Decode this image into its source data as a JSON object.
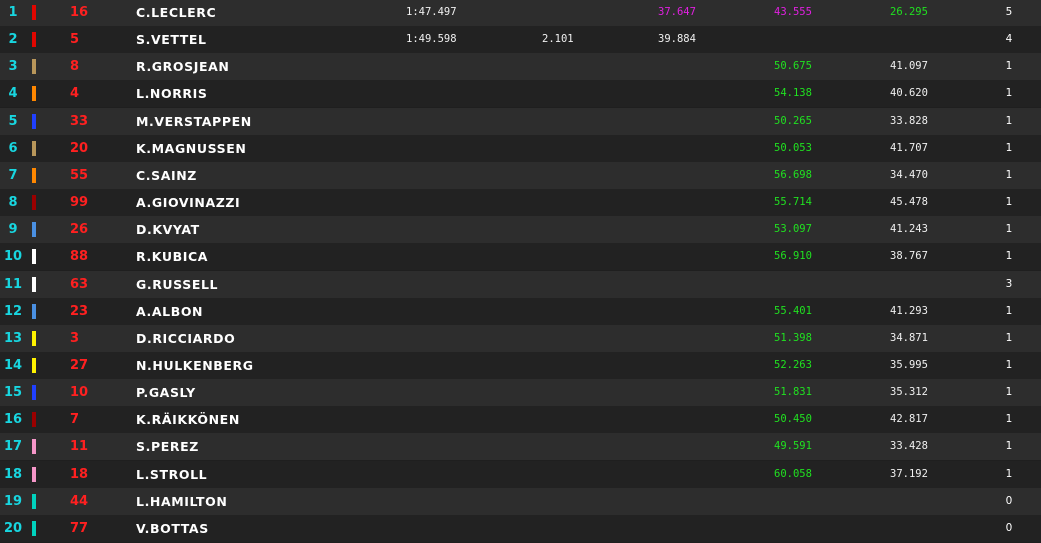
{
  "colors": {
    "position": "#18d6e0",
    "car_number": "#ff2020",
    "driver": "#ffffff",
    "purple_sector": "#e020e0",
    "green_sector": "#20e020",
    "row_odd": "#2d2d2d",
    "row_even": "#222222"
  },
  "rows": [
    {
      "pos": "1",
      "team_color": "#e10600",
      "num": "16",
      "driver": "C.LECLERC",
      "best": "1:47.497",
      "gap": "",
      "s1": "37.647",
      "s1_class": "purple",
      "s2": "43.555",
      "s2_class": "purple",
      "s3": "26.295",
      "s3_class": "green",
      "pits": "5"
    },
    {
      "pos": "2",
      "team_color": "#e10600",
      "num": "5",
      "driver": "S.VETTEL",
      "best": "1:49.598",
      "gap": "2.101",
      "s1": "39.884",
      "s1_class": "white",
      "s2": "",
      "s2_class": "white",
      "s3": "",
      "s3_class": "white",
      "pits": "4"
    },
    {
      "pos": "3",
      "team_color": "#b8965a",
      "num": "8",
      "driver": "R.GROSJEAN",
      "best": "",
      "gap": "",
      "s1": "",
      "s1_class": "white",
      "s2": "50.675",
      "s2_class": "green",
      "s3": "41.097",
      "s3_class": "white",
      "pits": "1"
    },
    {
      "pos": "4",
      "team_color": "#ff8700",
      "num": "4",
      "driver": "L.NORRIS",
      "best": "",
      "gap": "",
      "s1": "",
      "s1_class": "white",
      "s2": "54.138",
      "s2_class": "green",
      "s3": "40.620",
      "s3_class": "white",
      "pits": "1"
    },
    {
      "pos": "5",
      "team_color": "#2040ff",
      "num": "33",
      "driver": "M.VERSTAPPEN",
      "best": "",
      "gap": "",
      "s1": "",
      "s1_class": "white",
      "s2": "50.265",
      "s2_class": "green",
      "s3": "33.828",
      "s3_class": "white",
      "pits": "1"
    },
    {
      "pos": "6",
      "team_color": "#b8965a",
      "num": "20",
      "driver": "K.MAGNUSSEN",
      "best": "",
      "gap": "",
      "s1": "",
      "s1_class": "white",
      "s2": "50.053",
      "s2_class": "green",
      "s3": "41.707",
      "s3_class": "white",
      "pits": "1"
    },
    {
      "pos": "7",
      "team_color": "#ff8700",
      "num": "55",
      "driver": "C.SAINZ",
      "best": "",
      "gap": "",
      "s1": "",
      "s1_class": "white",
      "s2": "56.698",
      "s2_class": "green",
      "s3": "34.470",
      "s3_class": "white",
      "pits": "1"
    },
    {
      "pos": "8",
      "team_color": "#9b0000",
      "num": "99",
      "driver": "A.GIOVINAZZI",
      "best": "",
      "gap": "",
      "s1": "",
      "s1_class": "white",
      "s2": "55.714",
      "s2_class": "green",
      "s3": "45.478",
      "s3_class": "white",
      "pits": "1"
    },
    {
      "pos": "9",
      "team_color": "#4a90e2",
      "num": "26",
      "driver": "D.KVYAT",
      "best": "",
      "gap": "",
      "s1": "",
      "s1_class": "white",
      "s2": "53.097",
      "s2_class": "green",
      "s3": "41.243",
      "s3_class": "white",
      "pits": "1"
    },
    {
      "pos": "10",
      "team_color": "#ffffff",
      "num": "88",
      "driver": "R.KUBICA",
      "best": "",
      "gap": "",
      "s1": "",
      "s1_class": "white",
      "s2": "56.910",
      "s2_class": "green",
      "s3": "38.767",
      "s3_class": "white",
      "pits": "1"
    },
    {
      "pos": "11",
      "team_color": "#ffffff",
      "num": "63",
      "driver": "G.RUSSELL",
      "best": "",
      "gap": "",
      "s1": "",
      "s1_class": "white",
      "s2": "",
      "s2_class": "white",
      "s3": "",
      "s3_class": "white",
      "pits": "3"
    },
    {
      "pos": "12",
      "team_color": "#4a90e2",
      "num": "23",
      "driver": "A.ALBON",
      "best": "",
      "gap": "",
      "s1": "",
      "s1_class": "white",
      "s2": "55.401",
      "s2_class": "green",
      "s3": "41.293",
      "s3_class": "white",
      "pits": "1"
    },
    {
      "pos": "13",
      "team_color": "#fff200",
      "num": "3",
      "driver": "D.RICCIARDO",
      "best": "",
      "gap": "",
      "s1": "",
      "s1_class": "white",
      "s2": "51.398",
      "s2_class": "green",
      "s3": "34.871",
      "s3_class": "white",
      "pits": "1"
    },
    {
      "pos": "14",
      "team_color": "#fff200",
      "num": "27",
      "driver": "N.HULKENBERG",
      "best": "",
      "gap": "",
      "s1": "",
      "s1_class": "white",
      "s2": "52.263",
      "s2_class": "green",
      "s3": "35.995",
      "s3_class": "white",
      "pits": "1"
    },
    {
      "pos": "15",
      "team_color": "#2040ff",
      "num": "10",
      "driver": "P.GASLY",
      "best": "",
      "gap": "",
      "s1": "",
      "s1_class": "white",
      "s2": "51.831",
      "s2_class": "green",
      "s3": "35.312",
      "s3_class": "white",
      "pits": "1"
    },
    {
      "pos": "16",
      "team_color": "#9b0000",
      "num": "7",
      "driver": "K.RÄIKKÖNEN",
      "best": "",
      "gap": "",
      "s1": "",
      "s1_class": "white",
      "s2": "50.450",
      "s2_class": "green",
      "s3": "42.817",
      "s3_class": "white",
      "pits": "1"
    },
    {
      "pos": "17",
      "team_color": "#f596c8",
      "num": "11",
      "driver": "S.PEREZ",
      "best": "",
      "gap": "",
      "s1": "",
      "s1_class": "white",
      "s2": "49.591",
      "s2_class": "green",
      "s3": "33.428",
      "s3_class": "white",
      "pits": "1"
    },
    {
      "pos": "18",
      "team_color": "#f596c8",
      "num": "18",
      "driver": "L.STROLL",
      "best": "",
      "gap": "",
      "s1": "",
      "s1_class": "white",
      "s2": "60.058",
      "s2_class": "green",
      "s3": "37.192",
      "s3_class": "white",
      "pits": "1"
    },
    {
      "pos": "19",
      "team_color": "#00d2be",
      "num": "44",
      "driver": "L.HAMILTON",
      "best": "",
      "gap": "",
      "s1": "",
      "s1_class": "white",
      "s2": "",
      "s2_class": "white",
      "s3": "",
      "s3_class": "white",
      "pits": "0"
    },
    {
      "pos": "20",
      "team_color": "#00d2be",
      "num": "77",
      "driver": "V.BOTTAS",
      "best": "",
      "gap": "",
      "s1": "",
      "s1_class": "white",
      "s2": "",
      "s2_class": "white",
      "s3": "",
      "s3_class": "white",
      "pits": "0"
    }
  ]
}
